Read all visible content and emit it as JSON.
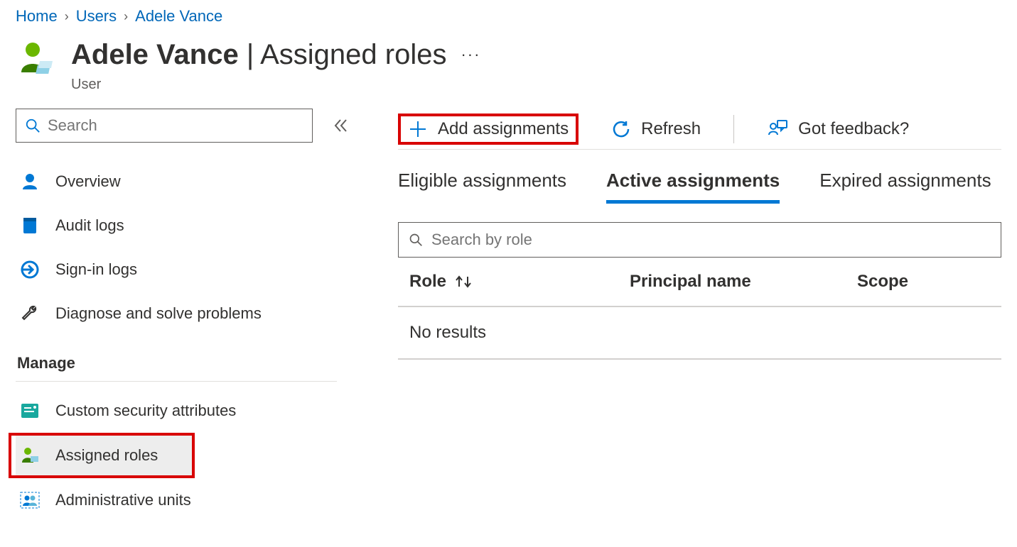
{
  "breadcrumb": {
    "items": [
      "Home",
      "Users",
      "Adele Vance"
    ]
  },
  "header": {
    "user_name": "Adele Vance",
    "page_section": "Assigned roles",
    "subtitle": "User"
  },
  "sidebar": {
    "search_placeholder": "Search",
    "items_top": [
      {
        "label": "Overview",
        "icon": "user"
      },
      {
        "label": "Audit logs",
        "icon": "book"
      },
      {
        "label": "Sign-in logs",
        "icon": "signin"
      },
      {
        "label": "Diagnose and solve problems",
        "icon": "wrench"
      }
    ],
    "group_label": "Manage",
    "items_manage": [
      {
        "label": "Custom security attributes",
        "icon": "attr"
      },
      {
        "label": "Assigned roles",
        "icon": "user-role",
        "active": true
      },
      {
        "label": "Administrative units",
        "icon": "admin-units"
      }
    ]
  },
  "toolbar": {
    "add_label": "Add assignments",
    "refresh_label": "Refresh",
    "feedback_label": "Got feedback?"
  },
  "tabs": {
    "items": [
      "Eligible assignments",
      "Active assignments",
      "Expired assignments"
    ],
    "active_index": 1
  },
  "role_search_placeholder": "Search by role",
  "table": {
    "columns": [
      "Role",
      "Principal name",
      "Scope"
    ],
    "rows": [],
    "empty_label": "No results"
  }
}
